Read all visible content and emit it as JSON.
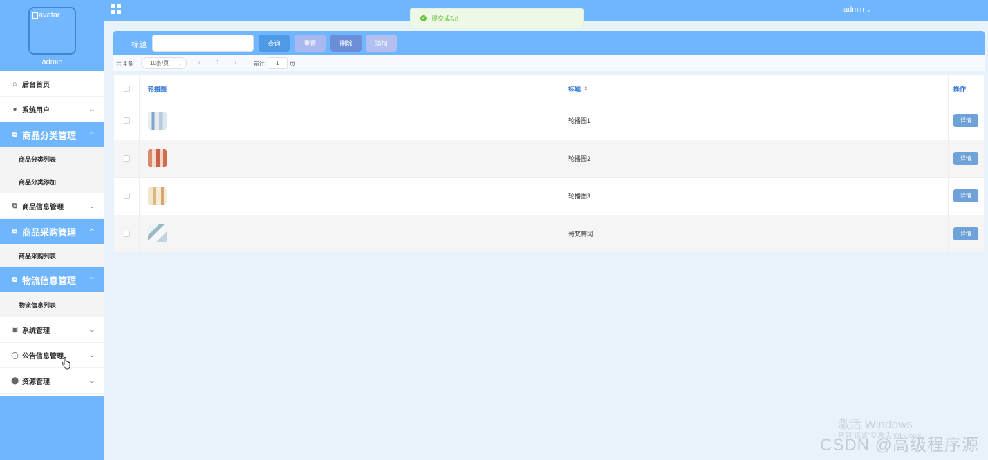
{
  "sidebar": {
    "avatar_alt": "avatar",
    "username": "admin",
    "menu": [
      {
        "label": "后台首页",
        "icon": "home-icon",
        "glyph": "⌂",
        "active": false,
        "expandable": false
      },
      {
        "label": "系统用户",
        "icon": "user-icon",
        "glyph": "●",
        "active": false,
        "expandable": true
      },
      {
        "label": "商品分类管理",
        "icon": "category-icon",
        "glyph": "⧉",
        "active": true,
        "expandable": true,
        "children": [
          "商品分类列表",
          "商品分类添加"
        ]
      },
      {
        "label": "商品信息管理",
        "icon": "goods-icon",
        "glyph": "⧉",
        "active": false,
        "expandable": true
      },
      {
        "label": "商品采购管理",
        "icon": "purchase-icon",
        "glyph": "⧉",
        "active": true,
        "expandable": true,
        "children": [
          "商品采购列表"
        ]
      },
      {
        "label": "物流信息管理",
        "icon": "logistics-icon",
        "glyph": "⧉",
        "active": true,
        "expandable": true,
        "children": [
          "物流信息列表"
        ]
      },
      {
        "label": "系统管理",
        "icon": "system-icon",
        "glyph": "▣",
        "active": false,
        "expandable": true
      },
      {
        "label": "公告信息管理",
        "icon": "notice-icon",
        "glyph": "ⓘ",
        "active": false,
        "expandable": true
      },
      {
        "label": "资源管理",
        "icon": "resource-icon",
        "glyph": "⬤",
        "active": false,
        "expandable": true
      }
    ]
  },
  "topbar": {
    "admin_label": "admin",
    "admin_caret": "⌄"
  },
  "toast": {
    "message": "提交成功!",
    "icon": "success-icon",
    "color": "#67c23a"
  },
  "search": {
    "label": "标题",
    "value": "",
    "buttons": {
      "query": "查询",
      "reset": "重置",
      "delete": "删除",
      "add": "添加"
    }
  },
  "pagination": {
    "total": "共 4 条",
    "page_size": "10条/页",
    "current_page": "1",
    "goto_prefix": "前往",
    "goto_value": "1",
    "goto_suffix": "页"
  },
  "table": {
    "headers": {
      "image": "轮播图",
      "title": "标题",
      "actions": "操作"
    },
    "rows": [
      {
        "title": "轮播图1",
        "thumb": "t1",
        "action": "详情"
      },
      {
        "title": "轮播图2",
        "thumb": "t2",
        "action": "详情"
      },
      {
        "title": "轮播图3",
        "thumb": "t3",
        "action": "详情"
      },
      {
        "title": "哥梵蒂冈",
        "thumb": "t4",
        "action": "详情"
      }
    ]
  },
  "watermarks": {
    "windows": "激活 Windows",
    "windows_sub": "转到\"设置\"以激活 Windows。",
    "csdn": "CSDN @高级程序源"
  },
  "colors": {
    "primary": "#70b6ff",
    "link": "#3478d4",
    "success": "#67c23a"
  }
}
